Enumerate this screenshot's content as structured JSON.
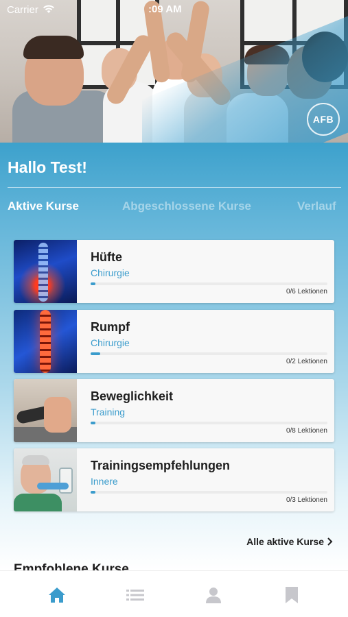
{
  "status_bar": {
    "carrier": "Carrier",
    "time": ":09 AM"
  },
  "header": {
    "logo_text": "AFB"
  },
  "greeting": "Hallo Test!",
  "tabs": [
    {
      "label": "Aktive Kurse",
      "active": true
    },
    {
      "label": "Abgeschlossene Kurse",
      "active": false
    },
    {
      "label": "Verlauf",
      "active": false
    }
  ],
  "courses": [
    {
      "title": "Hüfte",
      "category": "Chirurgie",
      "progress_text": "0/6 Lektionen",
      "progress": 0.02
    },
    {
      "title": "Rumpf",
      "category": "Chirurgie",
      "progress_text": "0/2 Lektionen",
      "progress": 0.04
    },
    {
      "title": "Beweglichkeit",
      "category": "Training",
      "progress_text": "0/8 Lektionen",
      "progress": 0.01
    },
    {
      "title": "Trainingsempfehlungen",
      "category": "Innere",
      "progress_text": "0/3 Lektionen",
      "progress": 0.02
    }
  ],
  "all_active_link": "Alle aktive Kurse",
  "recommended_heading": "Empfohlene Kurse",
  "bottom_nav": [
    {
      "icon": "home-icon",
      "active": true
    },
    {
      "icon": "list-icon",
      "active": false
    },
    {
      "icon": "profile-icon",
      "active": false
    },
    {
      "icon": "bookmark-icon",
      "active": false
    }
  ],
  "colors": {
    "accent": "#3b9ccc",
    "inactive_icon": "#c7c7cc"
  }
}
